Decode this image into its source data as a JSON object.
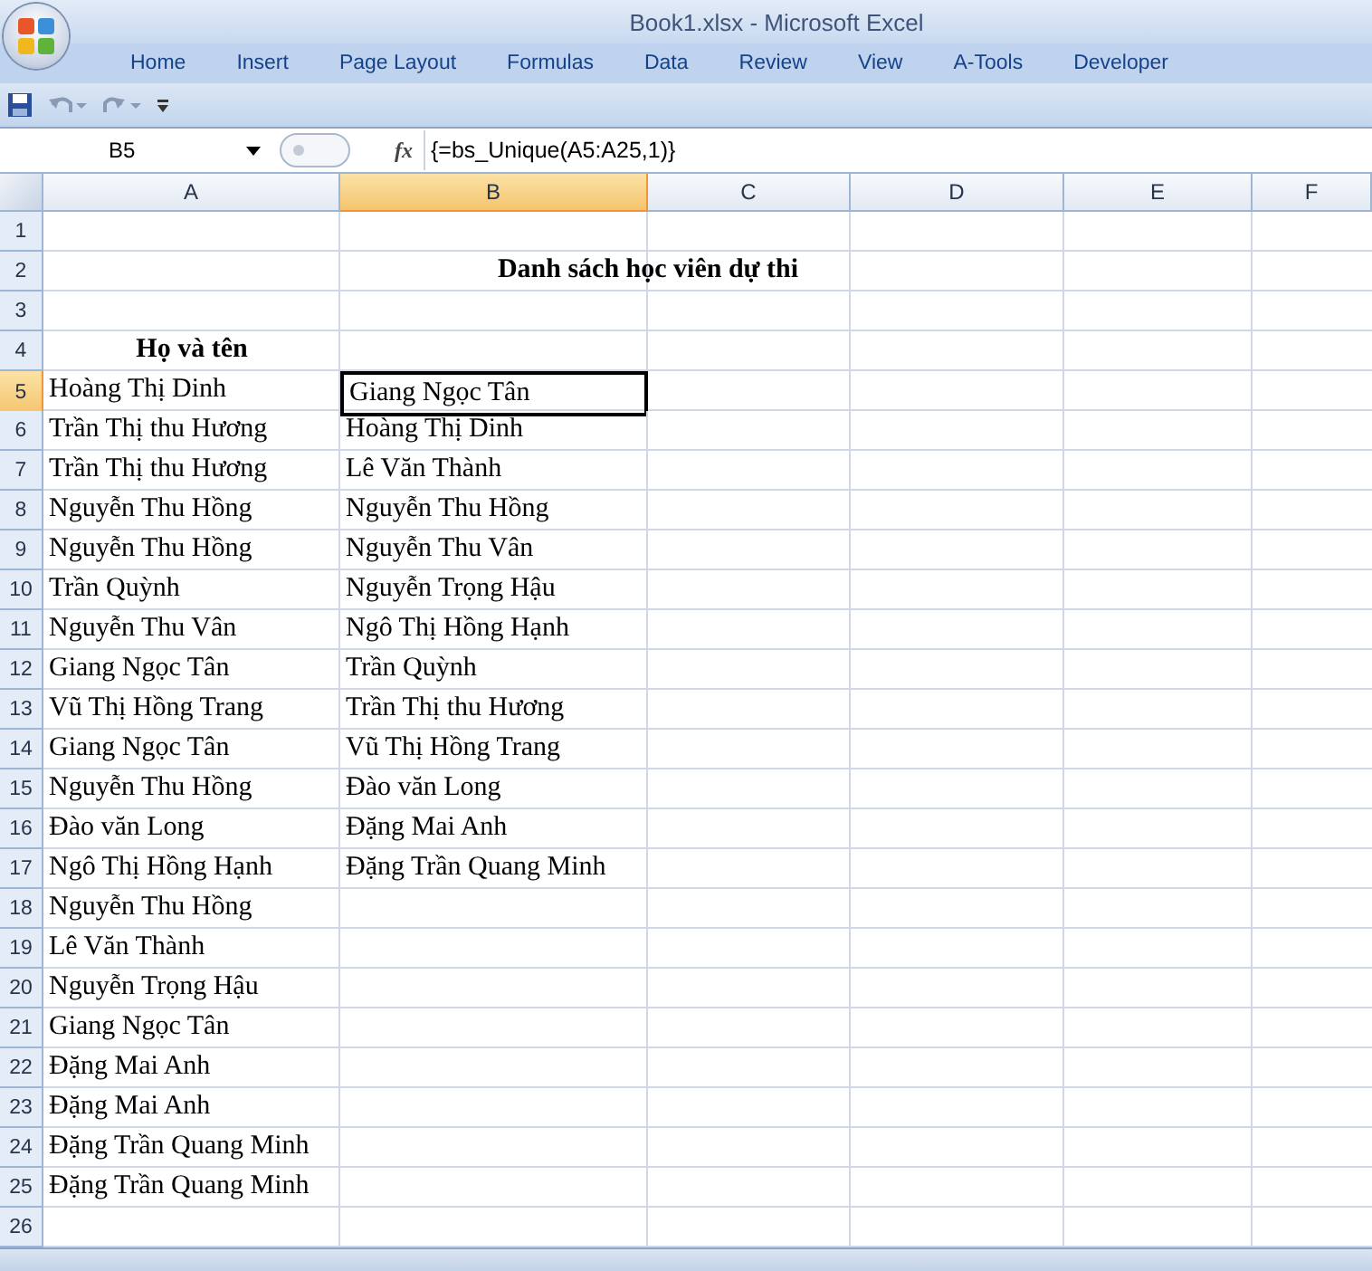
{
  "window": {
    "title": "Book1.xlsx - Microsoft Excel"
  },
  "ribbon_tabs": [
    {
      "label": "Home",
      "selected": false
    },
    {
      "label": "Insert",
      "selected": false
    },
    {
      "label": "Page Layout",
      "selected": false
    },
    {
      "label": "Formulas",
      "selected": false
    },
    {
      "label": "Data",
      "selected": false
    },
    {
      "label": "Review",
      "selected": false
    },
    {
      "label": "View",
      "selected": false
    },
    {
      "label": "A-Tools",
      "selected": false
    },
    {
      "label": "Developer",
      "selected": false
    }
  ],
  "formula_bar": {
    "name_box": "B5",
    "function_label": "fx",
    "formula": "{=bs_Unique(A5:A25,1)}"
  },
  "columns": [
    {
      "label": "A",
      "selected": false
    },
    {
      "label": "B",
      "selected": true
    },
    {
      "label": "C",
      "selected": false
    },
    {
      "label": "D",
      "selected": false
    },
    {
      "label": "E",
      "selected": false
    },
    {
      "label": "F",
      "selected": false
    }
  ],
  "rows": [
    {
      "number": "1",
      "selected": false,
      "kind": "empty"
    },
    {
      "number": "2",
      "selected": false,
      "kind": "title",
      "cells": [
        {
          "text": "Danh sách học viên dự thi",
          "active": false
        }
      ]
    },
    {
      "number": "3",
      "selected": false,
      "kind": "empty"
    },
    {
      "number": "4",
      "selected": false,
      "kind": "heading",
      "cells": [
        {
          "text": "Họ và tên",
          "active": false
        }
      ]
    },
    {
      "number": "5",
      "selected": true,
      "kind": "data",
      "cells": [
        {
          "text": "Hoàng Thị Dinh",
          "active": false
        },
        {
          "text": "Giang Ngọc Tân",
          "active": true
        }
      ]
    },
    {
      "number": "6",
      "selected": false,
      "kind": "data",
      "cells": [
        {
          "text": "Trần Thị thu Hương",
          "active": false
        },
        {
          "text": "Hoàng Thị Dinh",
          "active": false
        }
      ]
    },
    {
      "number": "7",
      "selected": false,
      "kind": "data",
      "cells": [
        {
          "text": "Trần Thị thu Hương",
          "active": false
        },
        {
          "text": "Lê Văn Thành",
          "active": false
        }
      ]
    },
    {
      "number": "8",
      "selected": false,
      "kind": "data",
      "cells": [
        {
          "text": "Nguyễn Thu Hồng",
          "active": false
        },
        {
          "text": "Nguyễn Thu Hồng",
          "active": false
        }
      ]
    },
    {
      "number": "9",
      "selected": false,
      "kind": "data",
      "cells": [
        {
          "text": "Nguyễn Thu Hồng",
          "active": false
        },
        {
          "text": "Nguyễn Thu Vân",
          "active": false
        }
      ]
    },
    {
      "number": "10",
      "selected": false,
      "kind": "data",
      "cells": [
        {
          "text": "Trần Quỳnh",
          "active": false
        },
        {
          "text": "Nguyễn Trọng Hậu",
          "active": false
        }
      ]
    },
    {
      "number": "11",
      "selected": false,
      "kind": "data",
      "cells": [
        {
          "text": "Nguyễn Thu Vân",
          "active": false
        },
        {
          "text": "Ngô Thị Hồng Hạnh",
          "active": false
        }
      ]
    },
    {
      "number": "12",
      "selected": false,
      "kind": "data",
      "cells": [
        {
          "text": "Giang Ngọc Tân",
          "active": false
        },
        {
          "text": "Trần Quỳnh",
          "active": false
        }
      ]
    },
    {
      "number": "13",
      "selected": false,
      "kind": "data",
      "cells": [
        {
          "text": "Vũ Thị Hồng Trang",
          "active": false
        },
        {
          "text": "Trần Thị thu Hương",
          "active": false
        }
      ]
    },
    {
      "number": "14",
      "selected": false,
      "kind": "data",
      "cells": [
        {
          "text": "Giang Ngọc Tân",
          "active": false
        },
        {
          "text": "Vũ Thị Hồng Trang",
          "active": false
        }
      ]
    },
    {
      "number": "15",
      "selected": false,
      "kind": "data",
      "cells": [
        {
          "text": "Nguyễn Thu Hồng",
          "active": false
        },
        {
          "text": "Đào văn Long",
          "active": false
        }
      ]
    },
    {
      "number": "16",
      "selected": false,
      "kind": "data",
      "cells": [
        {
          "text": "Đào văn Long",
          "active": false
        },
        {
          "text": "Đặng Mai Anh",
          "active": false
        }
      ]
    },
    {
      "number": "17",
      "selected": false,
      "kind": "data",
      "cells": [
        {
          "text": "Ngô Thị Hồng Hạnh",
          "active": false
        },
        {
          "text": "Đặng Trần Quang Minh",
          "active": false
        }
      ]
    },
    {
      "number": "18",
      "selected": false,
      "kind": "data",
      "cells": [
        {
          "text": "Nguyễn Thu Hồng",
          "active": false
        }
      ]
    },
    {
      "number": "19",
      "selected": false,
      "kind": "data",
      "cells": [
        {
          "text": "Lê Văn Thành",
          "active": false
        }
      ]
    },
    {
      "number": "20",
      "selected": false,
      "kind": "data",
      "cells": [
        {
          "text": "Nguyễn Trọng Hậu",
          "active": false
        }
      ]
    },
    {
      "number": "21",
      "selected": false,
      "kind": "data",
      "cells": [
        {
          "text": "Giang Ngọc Tân",
          "active": false
        }
      ]
    },
    {
      "number": "22",
      "selected": false,
      "kind": "data",
      "cells": [
        {
          "text": "Đặng Mai Anh",
          "active": false
        }
      ]
    },
    {
      "number": "23",
      "selected": false,
      "kind": "data",
      "cells": [
        {
          "text": "Đặng Mai Anh",
          "active": false
        }
      ]
    },
    {
      "number": "24",
      "selected": false,
      "kind": "data",
      "cells": [
        {
          "text": "Đặng Trần Quang Minh",
          "active": false
        }
      ]
    },
    {
      "number": "25",
      "selected": false,
      "kind": "data",
      "cells": [
        {
          "text": "Đặng Trần Quang Minh",
          "active": false
        }
      ]
    },
    {
      "number": "26",
      "selected": false,
      "kind": "empty"
    }
  ]
}
